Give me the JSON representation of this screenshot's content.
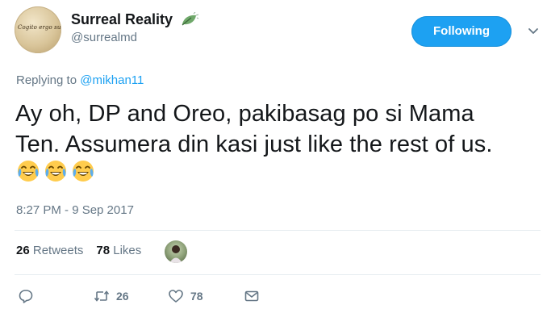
{
  "tweet": {
    "author": {
      "display_name": "Surreal Reality",
      "handle": "@surrealmd",
      "avatar_text": "Cogito ergo sum",
      "badge_icon": "leaf-icon"
    },
    "follow_button_label": "Following",
    "reply": {
      "prefix": "Replying to",
      "mention": "@mikhan11"
    },
    "text_line1": "Ay oh, DP and Oreo, pakibasag po si Mama",
    "text_line2": "Ten. Assumera din kasi just like the rest of us.",
    "emojis": [
      "face-with-tears-of-joy",
      "face-with-tears-of-joy",
      "face-with-tears-of-joy"
    ],
    "timestamp": "8:27 PM - 9 Sep 2017",
    "stats": {
      "retweets_count": "26",
      "retweets_label": "Retweets",
      "likes_count": "78",
      "likes_label": "Likes"
    },
    "actions": {
      "reply_icon": "reply-icon",
      "retweet_count": "26",
      "like_count": "78",
      "message_icon": "envelope-icon"
    }
  },
  "colors": {
    "accent": "#1da1f2",
    "text": "#14171a",
    "muted": "#657786",
    "divider": "#e6ecf0"
  }
}
